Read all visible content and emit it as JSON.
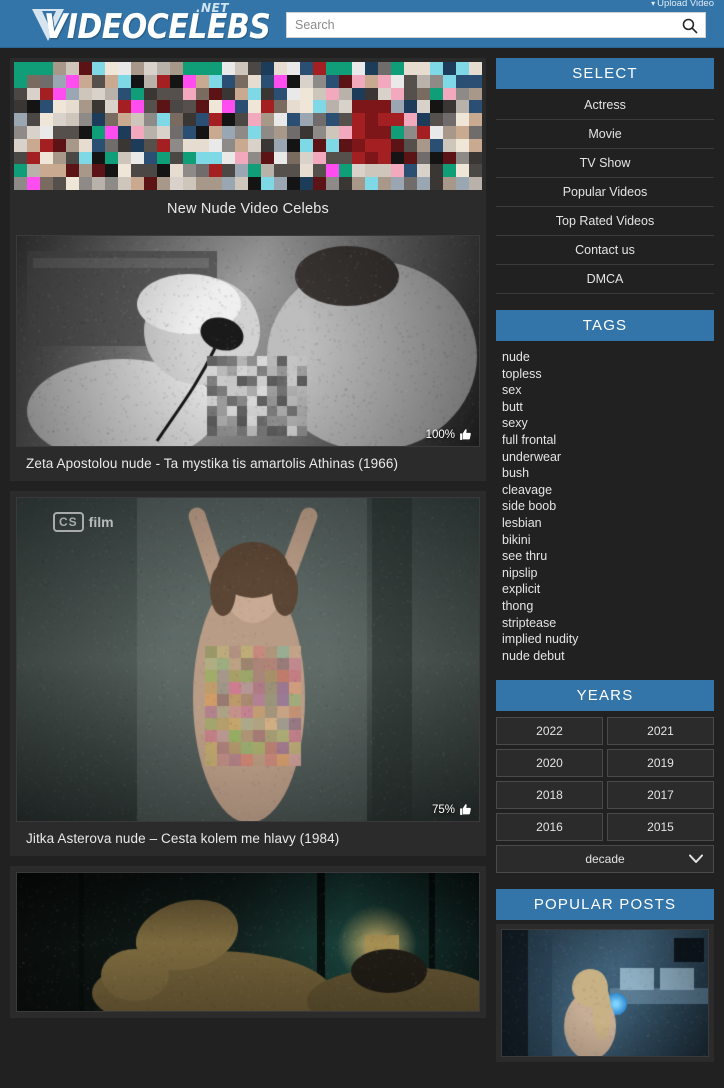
{
  "header": {
    "logo_main": "VIDEOCELEBS",
    "logo_tld": ".NET",
    "upload_label": "Upload Video",
    "upload_caret": "▾",
    "search_placeholder": "Search",
    "search_value": "",
    "accent_color": "#3375a8"
  },
  "main": {
    "banner_title": "New Nude Video Celebs",
    "videos": [
      {
        "title": "Zeta Apostolou nude - Ta mystika tis amartolis Athinas (1966)",
        "rating": "100%",
        "rating_icon": "thumbs-up-icon",
        "watermark": null
      },
      {
        "title": "Jitka Asterova nude – Cesta kolem me hlavy (1984)",
        "rating": "75%",
        "rating_icon": "thumbs-up-icon",
        "watermark_box": "CS",
        "watermark_word": "film"
      },
      {
        "title": "",
        "rating": "",
        "watermark": null
      }
    ]
  },
  "sidebar": {
    "select": {
      "heading": "SELECT",
      "items": [
        {
          "label": "Actress"
        },
        {
          "label": "Movie"
        },
        {
          "label": "TV Show"
        },
        {
          "label": "Popular Videos"
        },
        {
          "label": "Top Rated Videos"
        },
        {
          "label": "Contact us"
        },
        {
          "label": "DMCA"
        }
      ]
    },
    "tags": {
      "heading": "TAGS",
      "items": [
        "nude",
        "topless",
        "sex",
        "butt",
        "sexy",
        "full frontal",
        "underwear",
        "bush",
        "cleavage",
        "side boob",
        "lesbian",
        "bikini",
        "see thru",
        "nipslip",
        "explicit",
        "thong",
        "striptease",
        "implied nudity",
        "nude debut"
      ]
    },
    "years": {
      "heading": "YEARS",
      "items": [
        "2022",
        "2021",
        "2020",
        "2019",
        "2018",
        "2017",
        "2016",
        "2015"
      ],
      "decade_label": "decade",
      "decade_icon": "chevron-down-icon"
    },
    "popular": {
      "heading": "POPULAR POSTS"
    }
  }
}
